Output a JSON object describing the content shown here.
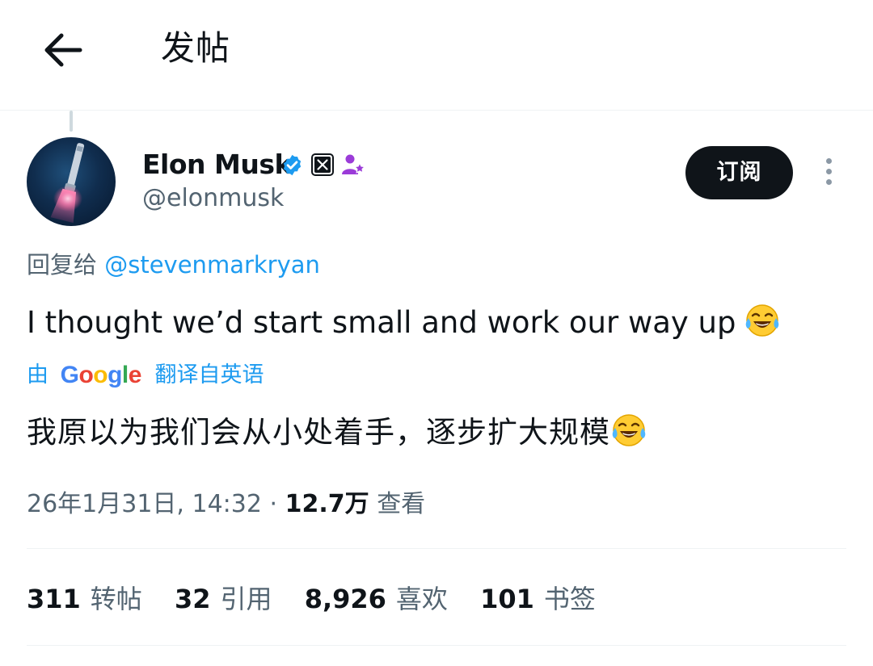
{
  "header": {
    "title": "发帖"
  },
  "author": {
    "name": "Elon Musk",
    "handle": "@elonmusk"
  },
  "actions": {
    "subscribe_label": "订阅"
  },
  "reply": {
    "prefix": "回复给",
    "to_handle": "@stevenmarkryan"
  },
  "post": {
    "text": "I thought we’d start small and work our way up",
    "emoji": "face-with-tears-of-joy"
  },
  "translation": {
    "by_label": "由",
    "provider": "Google",
    "from_label": "翻译自英语",
    "text": "我原以为我们会从小处着手，逐步扩大规模"
  },
  "meta": {
    "timestamp": "26年1月31日, 14:32",
    "separator": "·",
    "views_count": "12.7万",
    "views_label": "查看"
  },
  "stats": [
    {
      "count": "311",
      "label": "转帖"
    },
    {
      "count": "32",
      "label": "引用"
    },
    {
      "count": "8,926",
      "label": "喜欢"
    },
    {
      "count": "101",
      "label": "书签"
    }
  ],
  "colors": {
    "accent": "#1d9bf0",
    "text_primary": "#0f1419",
    "text_secondary": "#536471",
    "button_bg": "#0f1419",
    "affiliate_purple": "#9b3bd8"
  }
}
